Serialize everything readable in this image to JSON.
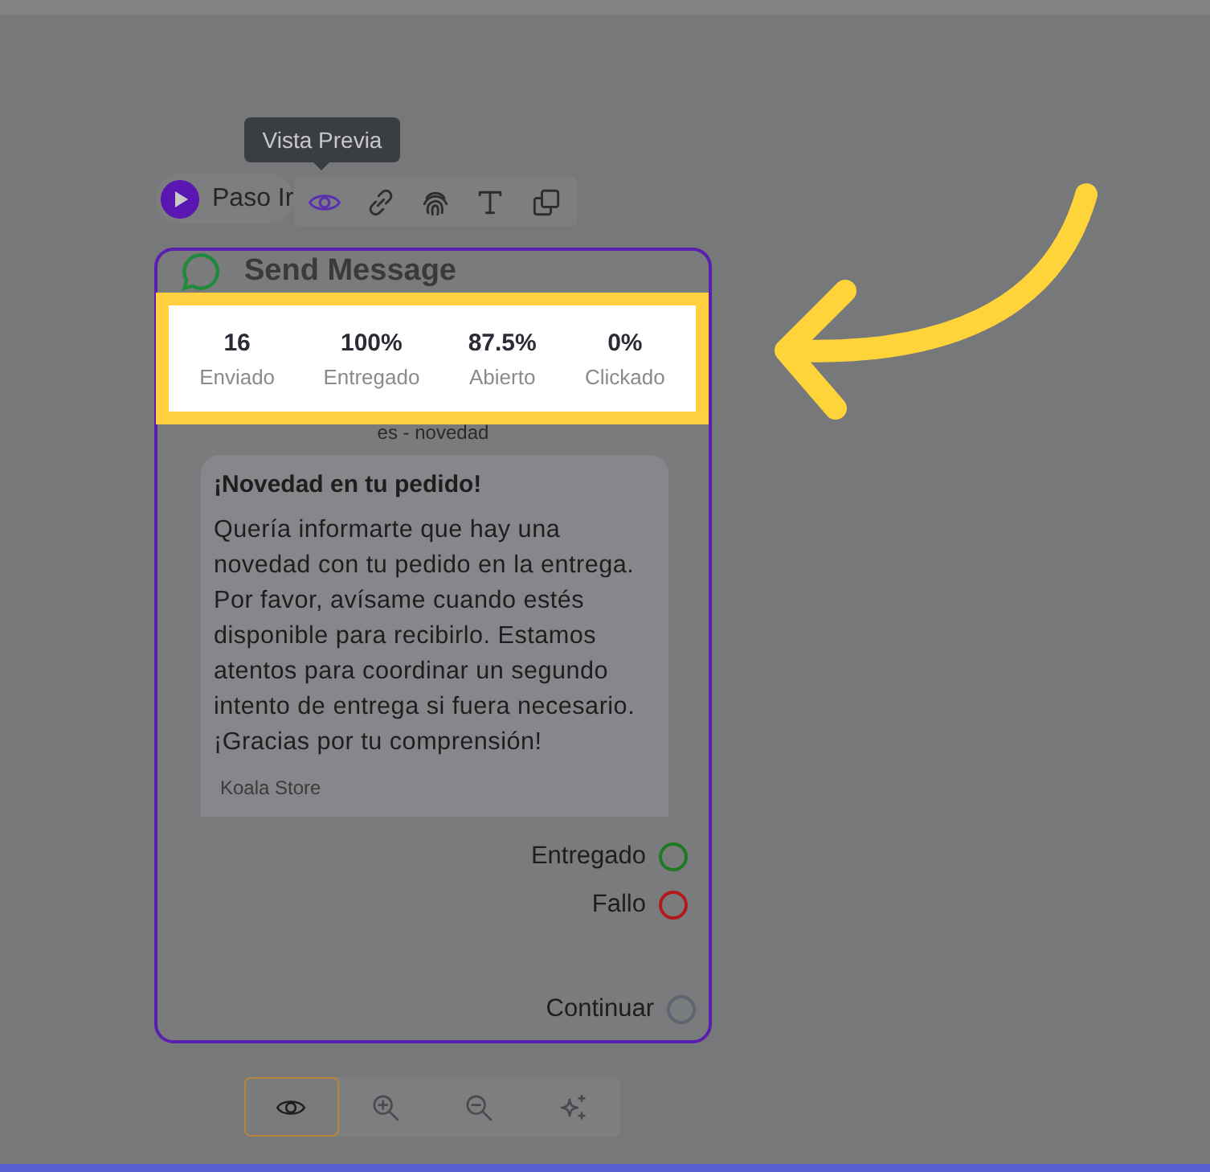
{
  "tooltip": {
    "text": "Vista Previa"
  },
  "node_toolbar": {
    "step_label": "Paso Ir",
    "tools": [
      {
        "kind": "eye",
        "selected": true
      },
      {
        "kind": "link",
        "selected": false
      },
      {
        "kind": "fingerprint",
        "selected": false
      },
      {
        "kind": "text",
        "selected": false
      },
      {
        "kind": "copy",
        "selected": false
      }
    ]
  },
  "card": {
    "title": "Send Message",
    "stats": [
      {
        "value": "16",
        "label": "Enviado"
      },
      {
        "value": "100%",
        "label": "Entregado"
      },
      {
        "value": "87.5%",
        "label": "Abierto"
      },
      {
        "value": "0%",
        "label": "Clickado"
      }
    ],
    "template": "es - novedad",
    "message": {
      "title": "¡Novedad en tu pedido!",
      "body": "Quería informarte que hay una novedad con tu pedido en la entrega. Por favor, avísame cuando estés disponible para recibirlo. Estamos atentos para coordinar un segundo intento de entrega si fuera necesario. ¡Gracias por tu comprensión!",
      "footer": "Koala Store"
    },
    "outputs": [
      {
        "label": "Entregado",
        "color": "#1e7a22"
      },
      {
        "label": "Fallo",
        "color": "#b3191c"
      },
      {
        "label": "Continuar",
        "color": "#5f6571"
      }
    ]
  },
  "view_controls": [
    {
      "kind": "eye",
      "selected": true
    },
    {
      "kind": "zoom-in",
      "selected": false
    },
    {
      "kind": "zoom-out",
      "selected": false
    },
    {
      "kind": "sparkle",
      "selected": false
    }
  ]
}
